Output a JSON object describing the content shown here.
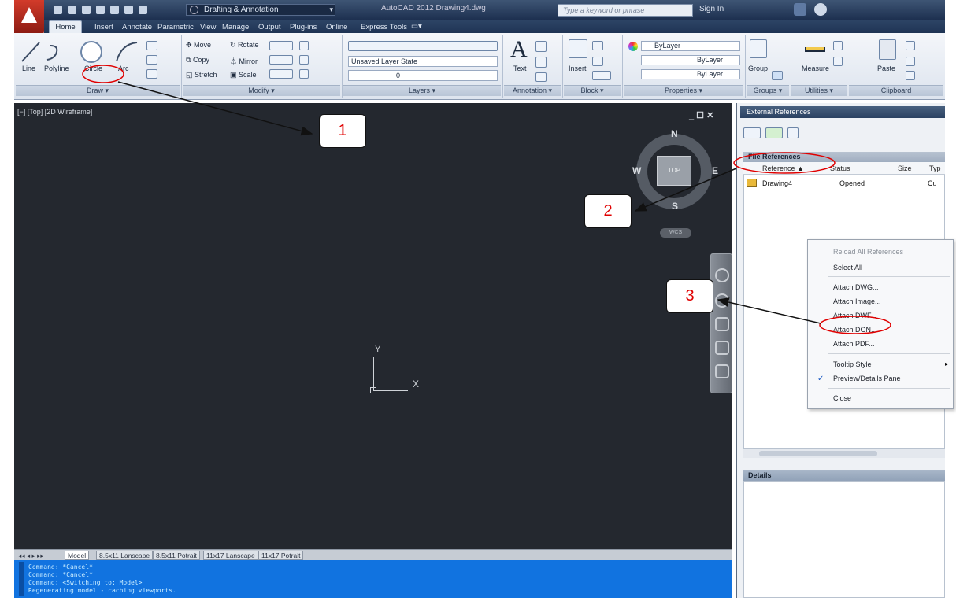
{
  "window": {
    "app_title": "AutoCAD 2012    Drawing4.dwg",
    "workspace": "Drafting & Annotation",
    "search_placeholder": "Type a keyword or phrase",
    "sign_in": "Sign In"
  },
  "ribbon_tabs": [
    "Home",
    "Insert",
    "Annotate",
    "Parametric",
    "View",
    "Manage",
    "Output",
    "Plug-ins",
    "Online",
    "Express Tools"
  ],
  "ribbon": {
    "draw": {
      "line": "Line",
      "polyline": "Polyline",
      "circle": "Circle",
      "arc": "Arc",
      "panel": "Draw ▾"
    },
    "modify": {
      "move": "Move",
      "copy": "Copy",
      "stretch": "Stretch",
      "rotate": "Rotate",
      "mirror": "Mirror",
      "scale": "Scale",
      "panel": "Modify ▾"
    },
    "layers": {
      "state": "Unsaved Layer State",
      "layer": "0",
      "panel": "Layers ▾"
    },
    "annotation": {
      "text": "Text",
      "panel": "Annotation ▾"
    },
    "block": {
      "insert": "Insert",
      "panel": "Block ▾"
    },
    "properties": {
      "color": "ByLayer",
      "linetype": "ByLayer",
      "lineweight": "ByLayer",
      "panel": "Properties ▾"
    },
    "groups": {
      "group": "Group",
      "panel": "Groups ▾"
    },
    "utilities": {
      "measure": "Measure",
      "panel": "Utilities ▾"
    },
    "clipboard": {
      "paste": "Paste",
      "panel": "Clipboard"
    }
  },
  "viewport": {
    "label": "[−] [Top] [2D Wireframe]",
    "controls": "_ ☐ ✕",
    "viewcube": {
      "n": "N",
      "s": "S",
      "e": "E",
      "w": "W",
      "face": "TOP",
      "wcs": "WCS"
    },
    "ucs": {
      "x": "X",
      "y": "Y"
    }
  },
  "layout_tabs": [
    "Model",
    "8.5x11 Lanscape",
    "8.5x11 Potrait",
    "11x17 Lanscape",
    "11x17 Potrait"
  ],
  "command_lines": [
    "Command: *Cancel*",
    "Command: *Cancel*",
    "Command:   <Switching to: Model>",
    "Regenerating model - caching viewports."
  ],
  "xref_palette": {
    "title": "External References",
    "file_refs_header": "File References",
    "columns": [
      "Reference ▲",
      "Status",
      "Size",
      "Typ"
    ],
    "rows": [
      {
        "name": "Drawing4",
        "status": "Opened",
        "type": "Cu"
      }
    ],
    "details": "Details"
  },
  "context_menu": {
    "items": [
      "Reload All References",
      "Select All",
      "Attach DWG...",
      "Attach Image...",
      "Attach DWF...",
      "Attach DGN...",
      "Attach PDF...",
      "Tooltip Style",
      "Preview/Details Pane",
      "Close"
    ],
    "check": "✓",
    "submenu_arrow": "▸"
  },
  "annotations": {
    "one": "1",
    "two": "2",
    "three": "3"
  },
  "colors": {
    "annotation_red": "#e00000",
    "command_bg": "#1173e0",
    "viewport_bg": "#24282f"
  }
}
